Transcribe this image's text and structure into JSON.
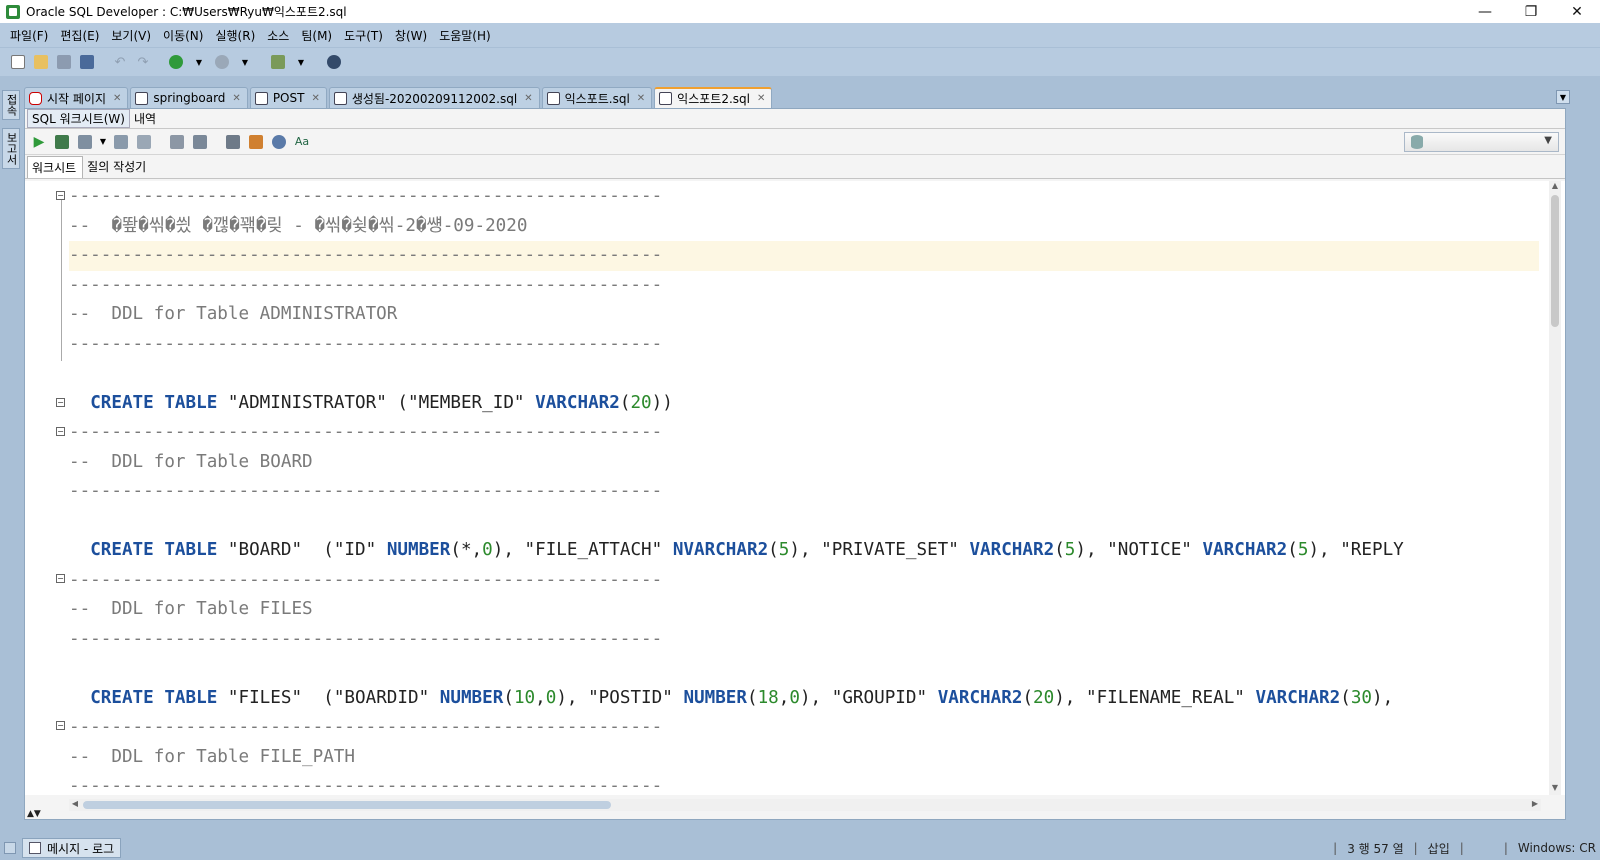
{
  "window": {
    "title": "Oracle SQL Developer : C:₩Users₩Ryu₩익스포트2.sql",
    "minimize": "—",
    "restore": "❐",
    "close": "✕"
  },
  "menu": [
    "파일(F)",
    "편집(E)",
    "보기(V)",
    "이동(N)",
    "실행(R)",
    "소스",
    "팀(M)",
    "도구(T)",
    "창(W)",
    "도움말(H)"
  ],
  "left_dock": {
    "tab1": "접속",
    "tab2": "보고서"
  },
  "tabs": [
    {
      "label": "시작 페이지",
      "icon": "oracle-start-icon"
    },
    {
      "label": "springboard",
      "icon": "sql-connection-icon"
    },
    {
      "label": "POST",
      "icon": "table-icon"
    },
    {
      "label": "생성됨-20200209112002.sql",
      "icon": "sql-file-icon"
    },
    {
      "label": "익스포트.sql",
      "icon": "sql-file-icon"
    },
    {
      "label": "익스포트2.sql",
      "icon": "sql-file-icon",
      "active": true
    }
  ],
  "subtabs": {
    "worksheet": "SQL 워크시트(W)",
    "history": "내역"
  },
  "ws_tabs": {
    "worksheet": "워크시트",
    "query_builder": "질의 작성기"
  },
  "code_lines": [
    {
      "kind": "comment",
      "text": "--------------------------------------------------------"
    },
    {
      "kind": "comment",
      "text": "--  �뙆�씪�씠 �깮�꽦�맂 - �씪�슂�씪-2�썡-09-2020"
    },
    {
      "kind": "comment",
      "text": "--------------------------------------------------------",
      "highlight": true
    },
    {
      "kind": "comment",
      "text": "--------------------------------------------------------"
    },
    {
      "kind": "comment",
      "text": "--  DDL for Table ADMINISTRATOR"
    },
    {
      "kind": "comment",
      "text": "--------------------------------------------------------"
    },
    {
      "kind": "blank",
      "text": ""
    },
    {
      "kind": "sql",
      "text": "  CREATE TABLE \"ADMINISTRATOR\" (\"MEMBER_ID\" VARCHAR2(20))"
    },
    {
      "kind": "comment",
      "text": "--------------------------------------------------------"
    },
    {
      "kind": "comment",
      "text": "--  DDL for Table BOARD"
    },
    {
      "kind": "comment",
      "text": "--------------------------------------------------------"
    },
    {
      "kind": "blank",
      "text": ""
    },
    {
      "kind": "sql",
      "text": "  CREATE TABLE \"BOARD\"  (\"ID\" NUMBER(*,0), \"FILE_ATTACH\" NVARCHAR2(5), \"PRIVATE_SET\" VARCHAR2(5), \"NOTICE\" VARCHAR2(5), \"REPLY"
    },
    {
      "kind": "comment",
      "text": "--------------------------------------------------------"
    },
    {
      "kind": "comment",
      "text": "--  DDL for Table FILES"
    },
    {
      "kind": "comment",
      "text": "--------------------------------------------------------"
    },
    {
      "kind": "blank",
      "text": ""
    },
    {
      "kind": "sql",
      "text": "  CREATE TABLE \"FILES\"  (\"BOARDID\" NUMBER(10,0), \"POSTID\" NUMBER(18,0), \"GROUPID\" VARCHAR2(20), \"FILENAME_REAL\" VARCHAR2(30),"
    },
    {
      "kind": "comment",
      "text": "--------------------------------------------------------"
    },
    {
      "kind": "comment",
      "text": "--  DDL for Table FILE_PATH"
    },
    {
      "kind": "comment",
      "text": "--------------------------------------------------------"
    }
  ],
  "bottom": {
    "messages_tab": "메시지 - 로그"
  },
  "status": {
    "position": "3 행 57 열",
    "mode": "삽입",
    "eol": "Windows: CR"
  },
  "colors": {
    "keyword": "#1c4f9c",
    "number": "#2c8a2c",
    "comment": "#7a7a7a",
    "current_line": "#fdf7e3",
    "active_tab_accent": "#f0a030"
  }
}
